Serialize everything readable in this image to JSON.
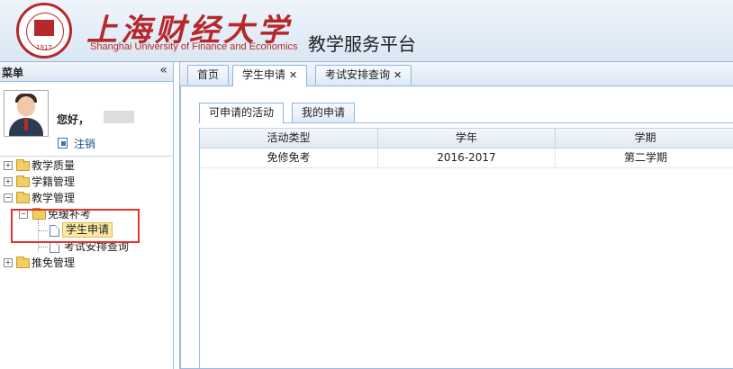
{
  "header": {
    "university_cn": "上海财经大学",
    "university_en": "Shanghai University of Finance and Economics",
    "platform_title": "教学服务平台",
    "seal_year": "1917"
  },
  "sidebar": {
    "title": "菜单",
    "collapse_glyph": "«",
    "greeting": "您好，",
    "logout": "注销",
    "tree": [
      {
        "label": "教学质量",
        "expander": "+"
      },
      {
        "label": "学籍管理",
        "expander": "+"
      },
      {
        "label": "教学管理",
        "expander": "−"
      },
      {
        "label": "免缓补考",
        "expander": "−"
      },
      {
        "label": "学生申请"
      },
      {
        "label": "考试安排查询"
      },
      {
        "label": "推免管理",
        "expander": "+"
      }
    ]
  },
  "tabs": [
    {
      "label": "首页"
    },
    {
      "label": "学生申请",
      "close": "✕"
    },
    {
      "label": "考试安排查询",
      "close": "✕"
    }
  ],
  "subtabs": [
    {
      "label": "可申请的活动"
    },
    {
      "label": "我的申请"
    }
  ],
  "grid": {
    "columns": [
      "活动类型",
      "学年",
      "学期"
    ],
    "rows": [
      [
        "免修免考",
        "2016-2017",
        "第二学期"
      ]
    ]
  },
  "colors": {
    "brand": "#b5282b",
    "border": "#99bbe8",
    "highlight": "#e0332f"
  }
}
